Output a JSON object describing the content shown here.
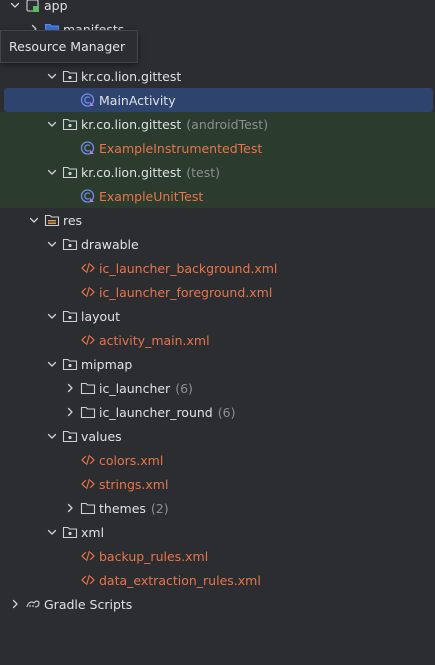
{
  "tooltip": "Resource Manager",
  "tree": {
    "app": "app",
    "manifests": "manifests",
    "pkg_main": "kr.co.lion.gittest",
    "main_activity": "MainActivity",
    "pkg_android_test": "kr.co.lion.gittest",
    "android_test_tag": "(androidTest)",
    "example_instrumented": "ExampleInstrumentedTest",
    "pkg_unit_test": "kr.co.lion.gittest",
    "unit_test_tag": "(test)",
    "example_unit": "ExampleUnitTest",
    "res": "res",
    "drawable": "drawable",
    "ic_bg": "ic_launcher_background.xml",
    "ic_fg": "ic_launcher_foreground.xml",
    "layout": "layout",
    "activity_main": "activity_main.xml",
    "mipmap": "mipmap",
    "ic_launcher": "ic_launcher",
    "ic_launcher_count": "(6)",
    "ic_launcher_round": "ic_launcher_round",
    "ic_launcher_round_count": "(6)",
    "values": "values",
    "colors": "colors.xml",
    "strings": "strings.xml",
    "themes": "themes",
    "themes_count": "(2)",
    "xml": "xml",
    "backup_rules": "backup_rules.xml",
    "data_extraction": "data_extraction_rules.xml",
    "gradle_scripts": "Gradle Scripts"
  },
  "icons": {
    "folder": "folder-icon",
    "package": "package-icon",
    "kotlin_class": "kotlin-class-icon",
    "xml_file": "xml-file-icon",
    "module": "module-icon",
    "gradle": "gradle-icon"
  },
  "colors": {
    "background": "#2b2d30",
    "selected": "#2e436e",
    "test_highlight": "#2b3b2d",
    "file_red": "#e8754a",
    "muted": "#8c8f94"
  }
}
